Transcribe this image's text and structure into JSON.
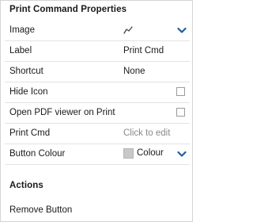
{
  "panel": {
    "title": "Print Command Properties"
  },
  "properties": {
    "image": {
      "label": "Image",
      "icon": "chart-line-icon"
    },
    "label": {
      "label": "Label",
      "value": "Print Cmd"
    },
    "shortcut": {
      "label": "Shortcut",
      "value": "None"
    },
    "hide_icon": {
      "label": "Hide Icon",
      "checked": false
    },
    "open_pdf_viewer": {
      "label": "Open PDF viewer on Print",
      "checked": false
    },
    "print_cmd": {
      "label": "Print Cmd",
      "placeholder": "Click to edit"
    },
    "button_colour": {
      "label": "Button Colour",
      "value": "Colour",
      "swatch_color": "#c8c8c8"
    }
  },
  "actions": {
    "title": "Actions",
    "remove_button": "Remove Button"
  },
  "colors": {
    "accent": "#1f5fa0",
    "border": "#d4d4d4",
    "row_divider": "#e3e3e3",
    "placeholder_text": "#8a8a8a"
  }
}
